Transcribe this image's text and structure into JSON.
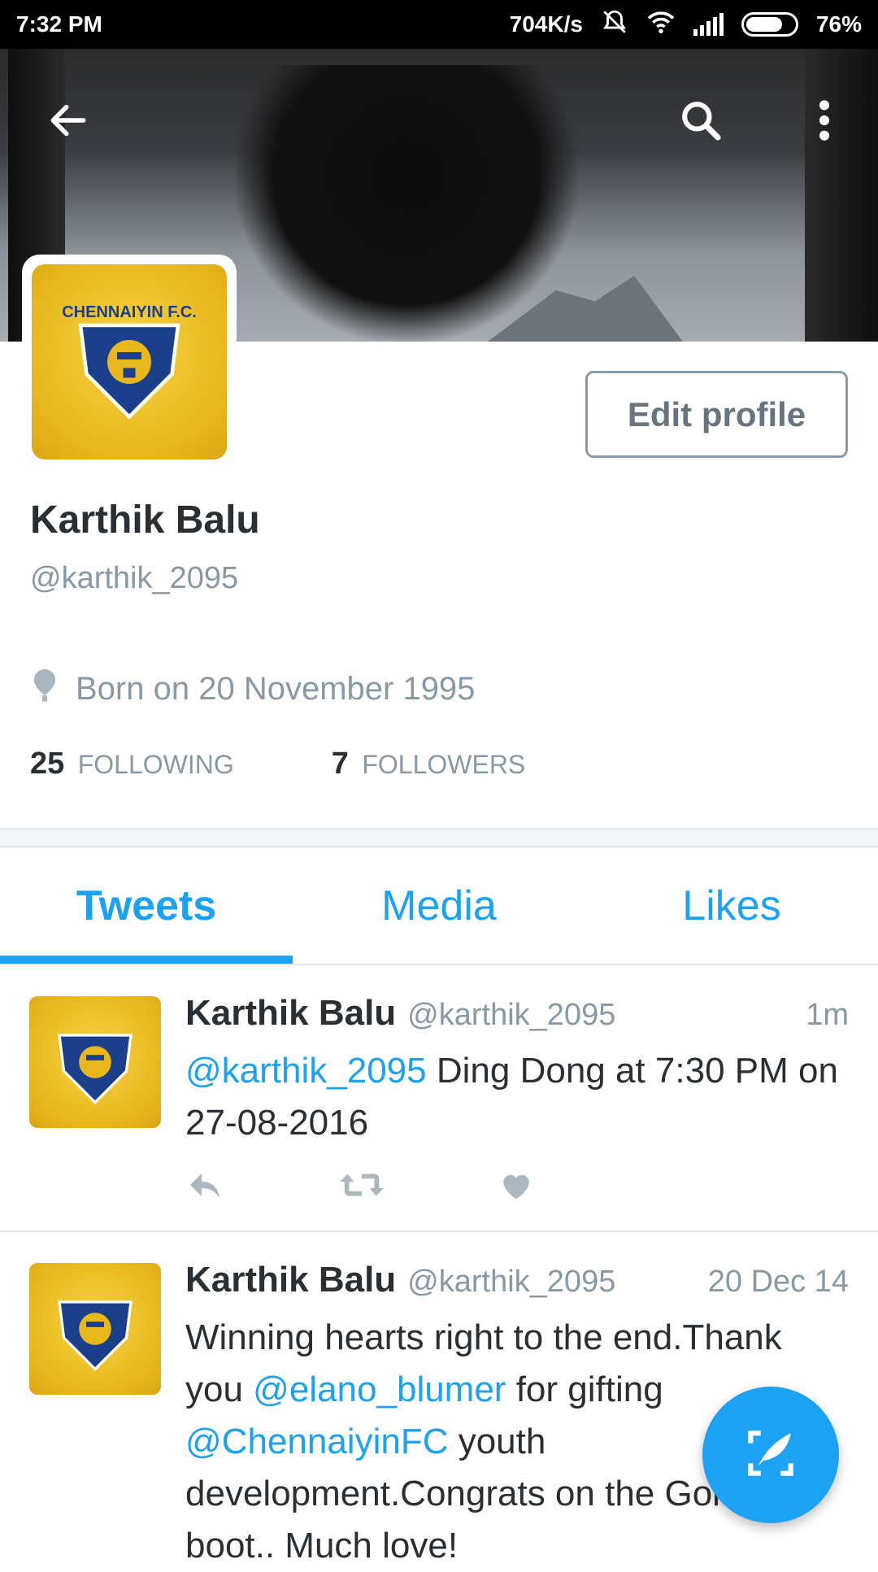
{
  "status_bar": {
    "time": "7:32 PM",
    "net_speed": "704K/s",
    "battery": "76%"
  },
  "profile": {
    "name": "Karthik Balu",
    "handle": "@karthik_2095",
    "bio": "Born on 20 November 1995",
    "edit_label": "Edit profile",
    "avatar_label": "CHENNAIYIN F.C.",
    "following_count": "25",
    "following_label": "FOLLOWING",
    "followers_count": "7",
    "followers_label": "FOLLOWERS"
  },
  "tabs": [
    {
      "label": "Tweets",
      "active": true
    },
    {
      "label": "Media",
      "active": false
    },
    {
      "label": "Likes",
      "active": false
    }
  ],
  "tweets": [
    {
      "name": "Karthik Balu",
      "handle": "@karthik_2095",
      "time": "1m",
      "mention": "@karthik_2095",
      "text_rest": " Ding Dong at  7:30 PM on 27-08-2016"
    },
    {
      "name": "Karthik Balu",
      "handle": "@karthik_2095",
      "time": "20 Dec 14",
      "text_1": "Winning hearts right to the end.Thank you ",
      "mention_1": "@elano_blumer",
      "text_2": " for gifting ",
      "mention_2": "@ChennaiyinFC",
      "text_3": " youth development.Congrats on the Golden boot.. Much love!"
    }
  ],
  "colors": {
    "accent": "#1da1f2",
    "text": "#292f33",
    "muted": "#8899a6"
  }
}
